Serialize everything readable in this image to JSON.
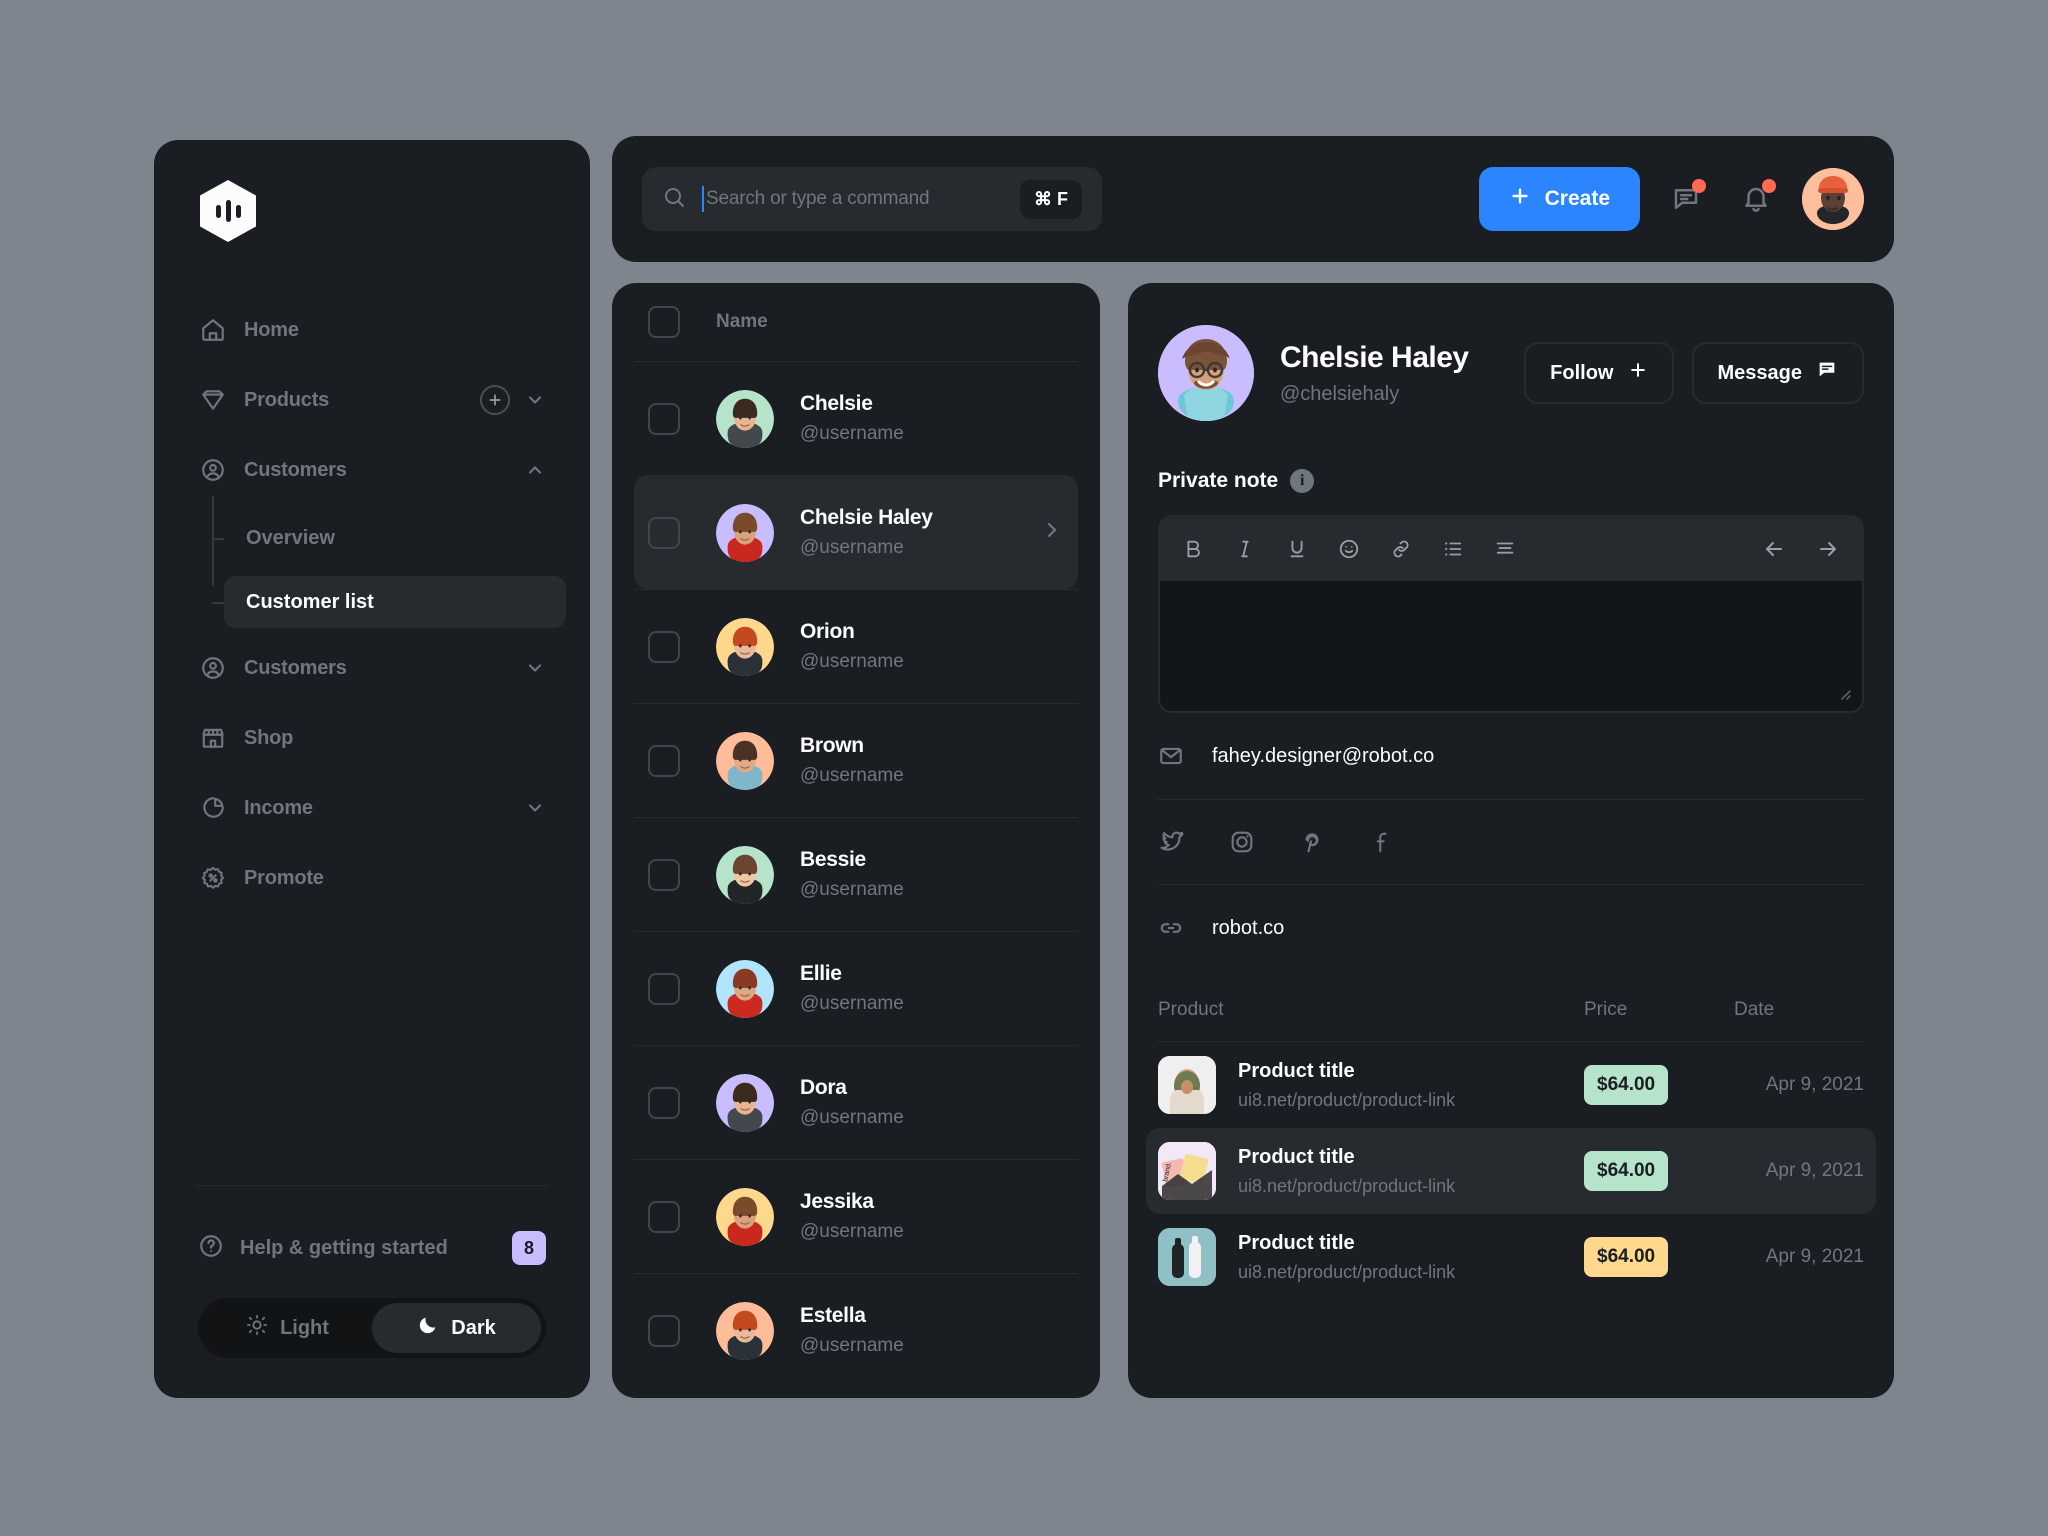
{
  "brand": {
    "logo_name": "app-logo"
  },
  "sidebar": {
    "items": [
      {
        "label": "Home",
        "icon": "home-icon"
      },
      {
        "label": "Products",
        "icon": "diamond-icon"
      },
      {
        "label": "Customers",
        "icon": "user-circle-icon"
      }
    ],
    "sub_items": [
      {
        "label": "Overview"
      },
      {
        "label": "Customer list"
      }
    ],
    "items_lower": [
      {
        "label": "Customers",
        "icon": "user-circle-icon"
      },
      {
        "label": "Shop",
        "icon": "store-icon"
      },
      {
        "label": "Income",
        "icon": "pie-chart-icon"
      },
      {
        "label": "Promote",
        "icon": "percent-badge-icon"
      }
    ],
    "help": {
      "label": "Help & getting started",
      "badge": "8",
      "badge_color": "#cabdff"
    },
    "theme": {
      "light_label": "Light",
      "dark_label": "Dark",
      "active": "Dark"
    }
  },
  "header": {
    "search_placeholder": "Search or type a command",
    "shortcut": "⌘ F",
    "create_label": "Create",
    "create_color": "#2a85ff",
    "notification_dot_color": "#ff6a55"
  },
  "customer_list": {
    "column_header": "Name",
    "rows": [
      {
        "name": "Chelsie",
        "username": "@username",
        "avatar_color": "#b5e4ca",
        "selected": false
      },
      {
        "name": "Chelsie Haley",
        "username": "@username",
        "avatar_color": "#cabdff",
        "selected": true
      },
      {
        "name": "Orion",
        "username": "@username",
        "avatar_color": "#ffd88d",
        "selected": false
      },
      {
        "name": "Brown",
        "username": "@username",
        "avatar_color": "#ffbc99",
        "selected": false
      },
      {
        "name": "Bessie",
        "username": "@username",
        "avatar_color": "#b5e4ca",
        "selected": false
      },
      {
        "name": "Ellie",
        "username": "@username",
        "avatar_color": "#b1e5fc",
        "selected": false
      },
      {
        "name": "Dora",
        "username": "@username",
        "avatar_color": "#cabdff",
        "selected": false
      },
      {
        "name": "Jessika",
        "username": "@username",
        "avatar_color": "#ffd88d",
        "selected": false
      },
      {
        "name": "Estella",
        "username": "@username",
        "avatar_color": "#ffbc99",
        "selected": false
      }
    ]
  },
  "detail": {
    "profile": {
      "name": "Chelsie Haley",
      "handle": "@chelsiehaly",
      "avatar_color": "#cabdff",
      "follow_label": "Follow",
      "message_label": "Message"
    },
    "note": {
      "label": "Private note",
      "toolbar": [
        "bold-icon",
        "italic-icon",
        "underline-icon",
        "emoji-icon",
        "link-icon",
        "list-icon",
        "align-icon"
      ],
      "undo": "arrow-left-icon",
      "redo": "arrow-right-icon",
      "value": ""
    },
    "email": "fahey.designer@robot.co",
    "socials": [
      "twitter-icon",
      "instagram-icon",
      "pinterest-icon",
      "facebook-icon"
    ],
    "website": "robot.co",
    "products_table": {
      "headers": {
        "product": "Product",
        "price": "Price",
        "date": "Date"
      },
      "rows": [
        {
          "title": "Product title",
          "link": "ui8.net/product/product-link",
          "price": "$64.00",
          "price_color": "#b5e4ca",
          "date": "Apr 9, 2021",
          "thumb_color": "#efefef",
          "highlighted": false
        },
        {
          "title": "Product title",
          "link": "ui8.net/product/product-link",
          "price": "$64.00",
          "price_color": "#b5e4ca",
          "date": "Apr 9, 2021",
          "thumb_color": "#f3e8f8",
          "highlighted": true
        },
        {
          "title": "Product title",
          "link": "ui8.net/product/product-link",
          "price": "$64.00",
          "price_color": "#ffd88d",
          "date": "Apr 9, 2021",
          "thumb_color": "#8fc0c6",
          "highlighted": false
        }
      ]
    }
  }
}
